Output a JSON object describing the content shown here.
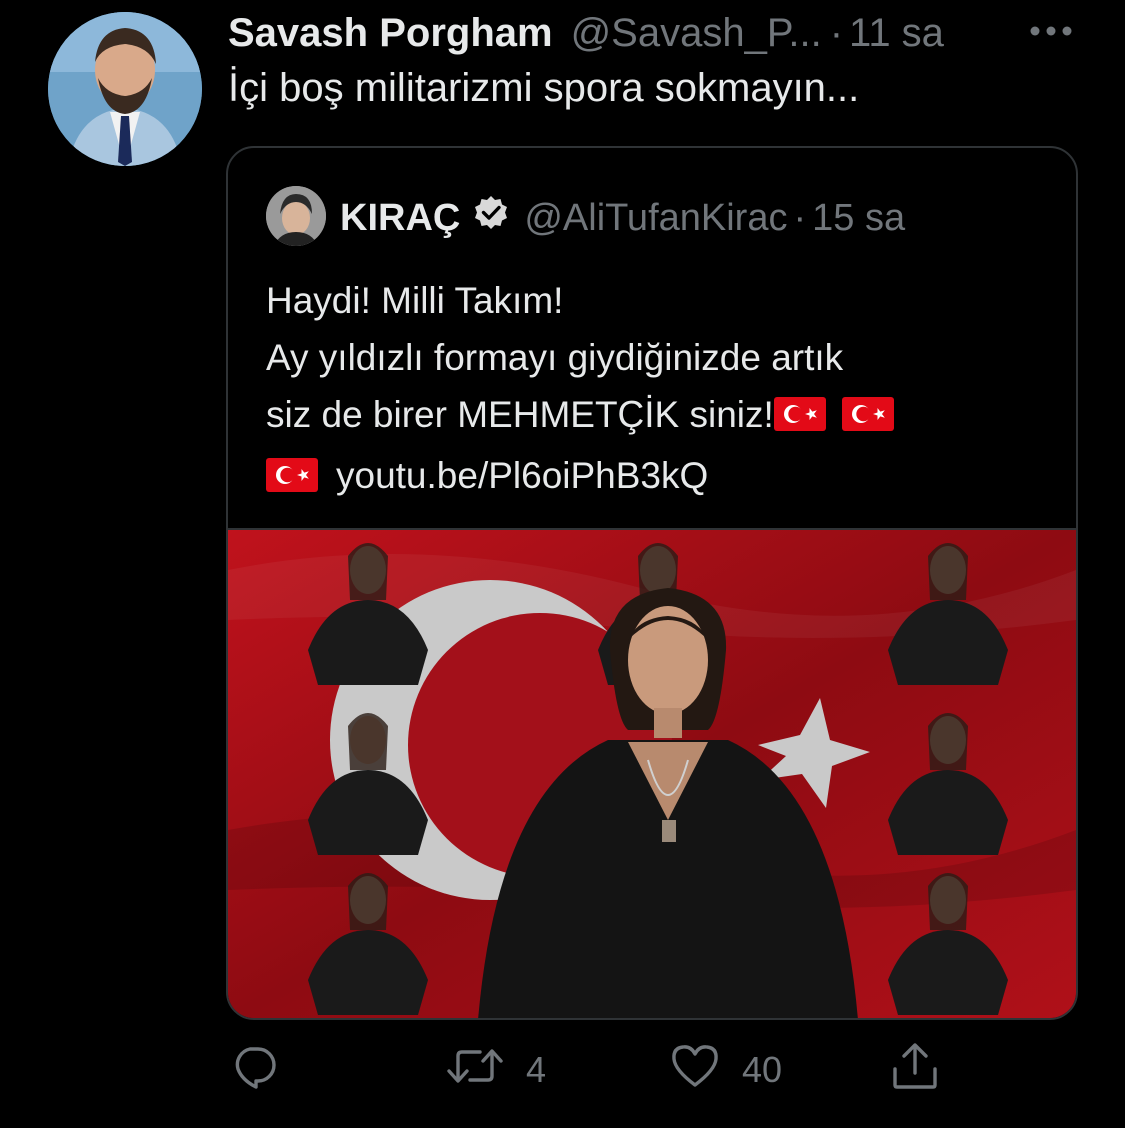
{
  "tweet": {
    "author_name": "Savash Porgham",
    "author_handle": "@Savash_P...",
    "separator": "·",
    "time": "11 sa",
    "text": "İçi boş militarizmi spora sokmayın...",
    "more_icon": "more-horizontal-icon"
  },
  "quoted": {
    "author_name": "KIRAÇ",
    "verified_icon": "verified-badge-icon",
    "author_handle": "@AliTufanKirac",
    "separator": "·",
    "time": "15 sa",
    "lines": [
      "Haydi! Milli Takım!",
      "Ay yıldızlı formayı giydiğinizde artık",
      "siz de birer MEHMETÇİK siniz!"
    ],
    "link": "youtu.be/Pl6oiPhB3kQ",
    "flag_icon": "turkey-flag-icon"
  },
  "actions": {
    "reply_icon": "reply-icon",
    "retweet_icon": "retweet-icon",
    "retweet_count": "4",
    "like_icon": "heart-icon",
    "like_count": "40",
    "share_icon": "share-icon"
  },
  "colors": {
    "background": "#000000",
    "text": "#e7e9ea",
    "muted": "#71767b",
    "border": "#2f3336",
    "flag_red": "#e30a17"
  }
}
